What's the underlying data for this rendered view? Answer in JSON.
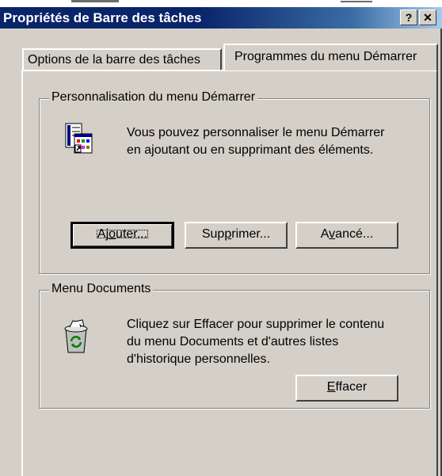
{
  "window": {
    "title": "Propriétés de Barre des tâches",
    "help_button": "?",
    "close_button": "✕"
  },
  "tabs": [
    {
      "label": "Options de la barre des tâches",
      "active": false
    },
    {
      "label": "Programmes du menu Démarrer",
      "active": true
    }
  ],
  "start_menu_group": {
    "legend": "Personnalisation du menu Démarrer",
    "description_line1": "Vous pouvez personnaliser le menu Démarrer",
    "description_line2": "en ajoutant ou en supprimant des éléments.",
    "icon": "start-menu-customize-icon",
    "buttons": {
      "add": {
        "label": "Ajouter...",
        "accel_pre": "Aj",
        "accel": "o",
        "accel_post": "uter..."
      },
      "remove": {
        "label": "Supprimer...",
        "accel_pre": "Sup",
        "accel": "p",
        "accel_post": "rimer..."
      },
      "advanced": {
        "label": "Avancé...",
        "accel_pre": "A",
        "accel": "v",
        "accel_post": "ancé..."
      }
    }
  },
  "documents_group": {
    "legend": "Menu Documents",
    "description_line1": "Cliquez sur Effacer pour supprimer le contenu",
    "description_line2": "du menu Documents et d'autres listes",
    "description_line3": "d'historique personnelles.",
    "icon": "recycle-bin-icon",
    "clear_button": {
      "label": "Effacer",
      "accel": "E",
      "accel_post": "ffacer"
    }
  }
}
